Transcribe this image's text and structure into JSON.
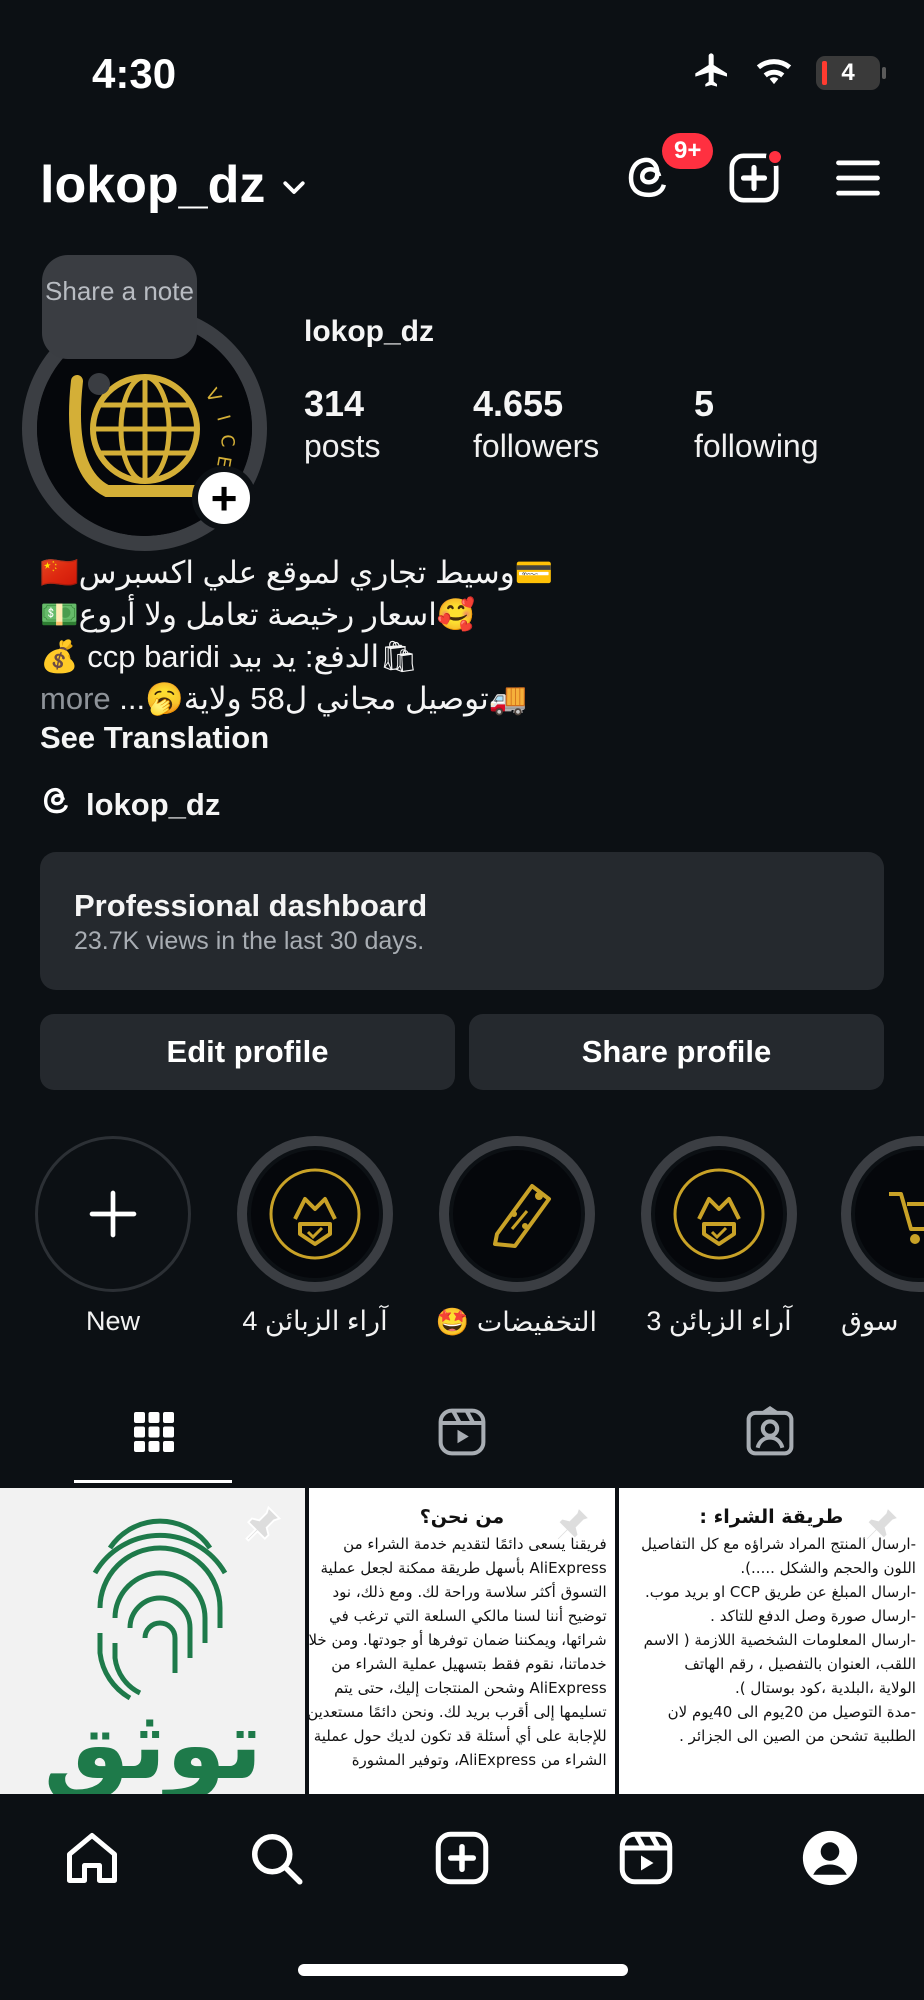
{
  "status_bar": {
    "time": "4:30",
    "battery": "4",
    "icons": [
      "airplane-icon",
      "wifi-icon",
      "battery-icon"
    ]
  },
  "header": {
    "username": "lokop_dz",
    "threads_badge": "9+",
    "icons": [
      "threads-icon",
      "create-icon",
      "menu-icon"
    ]
  },
  "profile": {
    "note_placeholder": "Share a note",
    "display_name": "lokop_dz",
    "stats": [
      {
        "value": "314",
        "label": "posts"
      },
      {
        "value": "4.655",
        "label": "followers"
      },
      {
        "value": "5",
        "label": "following"
      }
    ],
    "bio_lines": [
      "💳وسيط تجاري لموقع علي اكسبرس🇨🇳",
      "🥰اسعار رخيصة تعامل ولا أروع💵",
      "💰 ccp baridi الدفع: يد بيد🛍",
      "🚚توصيل مجاني ل58 ولاية🥱..."
    ],
    "bio_more": "more",
    "see_translation": "See Translation",
    "threads_link": "lokop_dz"
  },
  "dashboard": {
    "title": "Professional dashboard",
    "subtitle": "23.7K views in the last 30 days."
  },
  "buttons": {
    "edit": "Edit profile",
    "share": "Share profile"
  },
  "highlights": [
    {
      "label": "New"
    },
    {
      "label": "آراء الزبائن 4"
    },
    {
      "label": "التخفيضات 🤩"
    },
    {
      "label": "آراء الزبائن 3"
    },
    {
      "label": "سوق"
    }
  ],
  "tabs": [
    "grid-icon",
    "reels-icon",
    "tagged-icon"
  ],
  "posts": [
    {
      "title": "توثق",
      "type": "logo"
    },
    {
      "title": "من نحن؟",
      "lines": [
        "فريقنا يسعى دائمًا لتقديم خدمة الشراء من",
        "AliExpress بأسهل طريقة ممكنة لجعل عملية",
        "التسوق أكثر سلاسة وراحة لك. ومع ذلك، نود",
        "توضيح أننا لسنا مالكي السلعة التي ترغب في",
        "شرائها، ويمكننا ضمان توفرها أو جودتها. ومن خلال",
        "خدماتنا، نقوم فقط بتسهيل عملية الشراء من",
        "AliExpress وشحن المنتجات إليك، حتى يتم",
        "تسليمها إلى أقرب بريد لك. ونحن دائمًا مستعدين",
        "للإجابة على أي أسئلة قد تكون لديك حول عملية",
        "الشراء من AliExpress، وتوفير المشورة"
      ]
    },
    {
      "title": "طريقة الشراء :",
      "lines": [
        "-ارسال المنتج المراد شراؤه مع كل التفاصيل",
        "اللون والحجم والشكل .....).",
        "-ارسال المبلغ عن طريق CCP او بريد موب.",
        "-ارسال صورة وصل الدفع للتاكد .",
        "-ارسال المعلومات الشخصية اللازمة ( الاسم",
        "اللقب، العنوان بالتفصيل ، رقم الهاتف",
        "الولاية ،البلدية ،كود بوستال ).",
        "-مدة التوصيل من 20يوم الى 40يوم لان",
        "الطلبية تشحن من الصين الى الجزائر ."
      ]
    }
  ],
  "bottom_nav": [
    "home-icon",
    "search-icon",
    "create-icon",
    "reels-icon",
    "profile-icon"
  ]
}
